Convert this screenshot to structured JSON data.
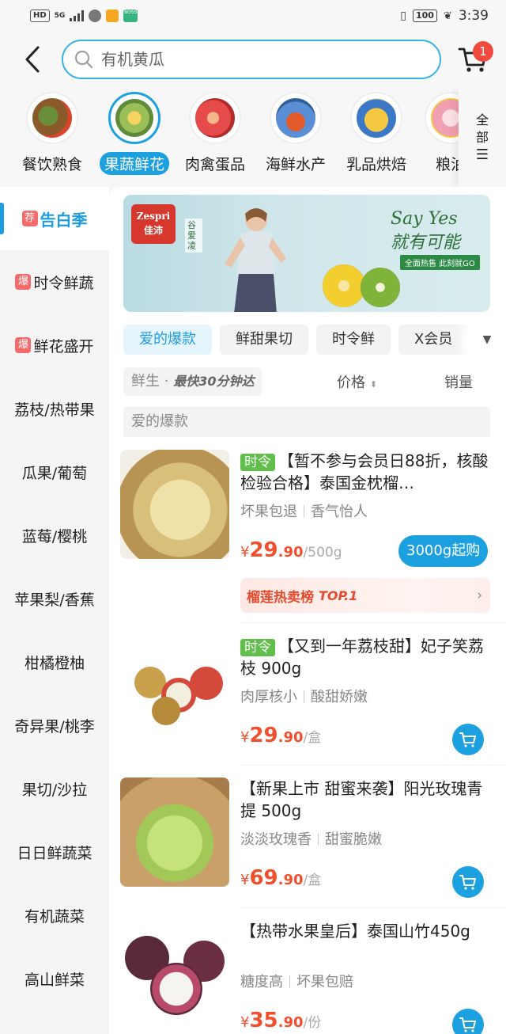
{
  "status_bar": {
    "hd": "HD",
    "network": "5G",
    "battery": "100",
    "time": "3:39"
  },
  "search": {
    "placeholder": "有机黄瓜",
    "cart_badge": "1"
  },
  "categories": [
    {
      "label": "餐饮熟食",
      "active": false,
      "color": "#8b5a2b"
    },
    {
      "label": "果蔬鲜花",
      "active": true,
      "color": "#9bbf58"
    },
    {
      "label": "肉禽蛋品",
      "active": false,
      "color": "#e64b4b"
    },
    {
      "label": "海鲜水产",
      "active": false,
      "color": "#5a8fd6"
    },
    {
      "label": "乳品烘焙",
      "active": false,
      "color": "#f5c842"
    },
    {
      "label": "粮油",
      "active": false,
      "color": "#f0a0b0"
    }
  ],
  "all_button": {
    "label": "全部"
  },
  "sidebar": {
    "items": [
      {
        "tag": "荐",
        "label": "告白季",
        "active": true
      },
      {
        "tag": "爆",
        "label": "时令鲜蔬",
        "active": false
      },
      {
        "tag": "爆",
        "label": "鲜花盛开",
        "active": false
      },
      {
        "tag": "",
        "label": "荔枝/热带果",
        "active": false
      },
      {
        "tag": "",
        "label": "瓜果/葡萄",
        "active": false
      },
      {
        "tag": "",
        "label": "蓝莓/樱桃",
        "active": false
      },
      {
        "tag": "",
        "label": "苹果梨/香蕉",
        "active": false
      },
      {
        "tag": "",
        "label": "柑橘橙柚",
        "active": false
      },
      {
        "tag": "",
        "label": "奇异果/桃李",
        "active": false
      },
      {
        "tag": "",
        "label": "果切/沙拉",
        "active": false
      },
      {
        "tag": "",
        "label": "日日鲜蔬菜",
        "active": false
      },
      {
        "tag": "",
        "label": "有机蔬菜",
        "active": false
      },
      {
        "tag": "",
        "label": "高山鲜菜",
        "active": false
      }
    ]
  },
  "banner": {
    "brand": "Zespri",
    "brand_cn": "佳沛",
    "side_text": "谷爱凌",
    "slogan_en": "Say Yes",
    "slogan_cn": "就有可能",
    "cta": "全面热售 此刻就GO"
  },
  "filter_chips": [
    {
      "label": "爱的爆款",
      "active": true
    },
    {
      "label": "鲜甜果切",
      "active": false
    },
    {
      "label": "时令鲜",
      "active": false
    },
    {
      "label": "X会员",
      "active": false
    }
  ],
  "sort_bar": {
    "fresh_prefix": "鲜生 ·",
    "fresh_slogan": "最快30分钟达",
    "price": "价格",
    "sales": "销量"
  },
  "section_title": "爱的爆款",
  "products": [
    {
      "tag": "时令",
      "title": "【暂不参与会员日88折，核酸检验合格】泰国金枕榴…",
      "features": [
        "坏果包退",
        "香气怡人"
      ],
      "price_int": "29",
      "price_dec": ".90",
      "unit": "/500g",
      "buy_label": "3000g起购",
      "rank_label": "榴莲热卖榜",
      "rank_badge": "TOP.1"
    },
    {
      "tag": "时令",
      "title": "【又到一年荔枝甜】妃子笑荔枝 900g",
      "features": [
        "肉厚核小",
        "酸甜娇嫩"
      ],
      "price_int": "29",
      "price_dec": ".90",
      "unit": "/盒"
    },
    {
      "tag": "",
      "title": "【新果上市 甜蜜来袭】阳光玫瑰青提 500g",
      "features": [
        "淡淡玫瑰香",
        "甜蜜脆嫩"
      ],
      "price_int": "69",
      "price_dec": ".90",
      "unit": "/盒"
    },
    {
      "tag": "",
      "title": "【热带水果皇后】泰国山竹450g",
      "features": [
        "糖度高",
        "坏果包赔"
      ],
      "price_int": "35",
      "price_dec": ".90",
      "unit": "/份"
    }
  ],
  "colors": {
    "accent": "#1da0e0",
    "price": "#f0502d",
    "tag_green": "#5fbf4a"
  }
}
